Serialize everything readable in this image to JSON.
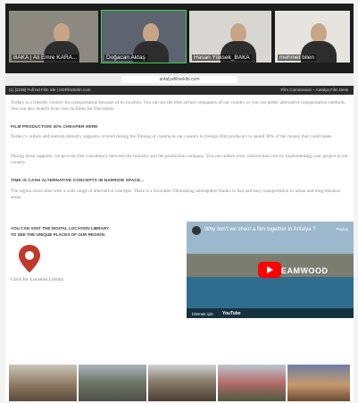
{
  "call": {
    "participants": [
      {
        "name": "BAKA | Ali Emre KARA...",
        "active": false
      },
      {
        "name": "Doğacan Aktaş",
        "active": true
      },
      {
        "name": "Hasan Yüksek_BAKA",
        "active": false
      },
      {
        "name": "mehmet bilen",
        "active": false
      }
    ]
  },
  "browser": {
    "url": "antalyafilmekibi.com",
    "tab_left": "(1) [2236] Full Hd Film izle | HDFilmSehri.com",
    "tab_right": "Film Commission – Antalya Film Desk"
  },
  "page": {
    "intro": "Turkey is a friendly country for transportation because of its location. You can see the elite airline companies of our country or you can prefer alternative transportation methods. You can also benefit from visa facilities for film teams.",
    "section1": {
      "heading": "FILM PRODUCTION 30% CHEAPER HERE",
      "para1": "Turkey's culture and tourism ministry supports covered during the filming of cinema in our country to foreign film producers to spend 30% of the money that could make.",
      "para2": "During these supports, we provide free consultancy between the ministry and the production company. You can reduce your construction cost by implementing your project in our country."
    },
    "section2": {
      "heading": "TIME IS CASH ALTERNATIVE CONCEPTS IN NARROW SPACE...",
      "para": "The region saves time with a wide range of alternative concepts. There is a favorable filmmaking atmosphere thanks to fast and easy transportation in urban and long-distance areas."
    },
    "library": {
      "title_line1": "YOU CAN VISIT THE DIGITAL LOCATION LIBRARY",
      "title_line2": "TO SEE THE UNIQUE PLACES OF OUR REGION.",
      "link": "Click for Location Library",
      "pin_color": "#c0392b"
    },
    "video": {
      "title": "Why don't we shoot a film together in Antalya ?",
      "share": "Paylaş",
      "brand": "EAMWOOD",
      "watch_on": "İzlemek için:",
      "platform": "YouTube"
    }
  },
  "colors": {
    "active_speaker": "#39d04a",
    "play_button": "#ff0000"
  }
}
